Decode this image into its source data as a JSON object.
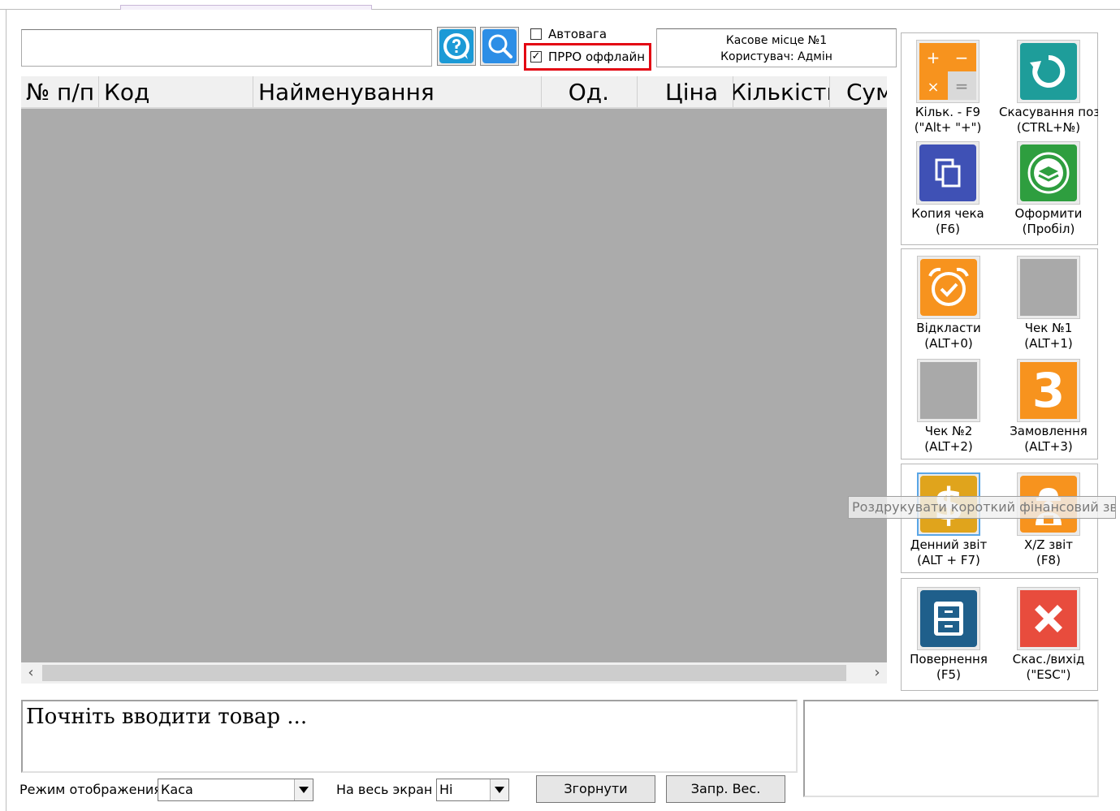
{
  "search": {
    "value": ""
  },
  "options": {
    "autoweight": {
      "label": "Автовага",
      "checked": false
    },
    "prro_offline": {
      "label": "ПРРО оффлайн",
      "checked": true,
      "check_mark": "✓"
    }
  },
  "info": {
    "register": "Касове місце №1",
    "user": "Користувач: Адмін"
  },
  "grid": {
    "columns": [
      "№ п/п",
      "Код",
      "Найменування",
      "Од.",
      "Ціна",
      "Кількість",
      "Сума"
    ]
  },
  "scroll": {
    "left_arrow": "‹",
    "right_arrow": "›"
  },
  "buttons": {
    "qty": {
      "line1": "Кільк. - F9",
      "line2": "(\"Alt+ \"+\")"
    },
    "cancel_pos": {
      "line1": "Скасування поз.",
      "line2": "(CTRL+№)"
    },
    "copy_receipt": {
      "line1": "Копия чека",
      "line2": "(F6)"
    },
    "checkout": {
      "line1": "Оформити",
      "line2": "(Пробіл)"
    },
    "postpone": {
      "line1": "Відкласти",
      "line2": "(ALT+0)"
    },
    "receipt1": {
      "line1": "Чек №1",
      "line2": "(ALT+1)"
    },
    "receipt2": {
      "line1": "Чек №2",
      "line2": "(ALT+2)"
    },
    "order": {
      "line1": "Замовлення",
      "line2": "(ALT+3)",
      "glyph": "3"
    },
    "daily_report": {
      "line1": "Денний звіт",
      "line2": "(ALT + F7)",
      "glyph": "$"
    },
    "xz_report": {
      "line1": "X/Z звіт",
      "line2": "(F8)"
    },
    "return": {
      "line1": "Повернення",
      "line2": "(F5)"
    },
    "cancel_exit": {
      "line1": "Скас./вихід",
      "line2": "(\"ESC\")"
    }
  },
  "tooltip": "Роздрукувати короткий фінансовий звіт",
  "message": "Почніть вводити товар ...",
  "bottom": {
    "mode_label": "Режим отображения",
    "mode_value": "Каса",
    "fullscreen_label": "На весь экран",
    "fullscreen_value": "Hi",
    "collapse_button": "Згорнути",
    "weight_button": "Запр. Вес."
  },
  "colors": {
    "accent_orange": "#f7931e",
    "highlight_red": "#e30613",
    "grid_gray": "#ababab",
    "blue": "#1c9ad6"
  }
}
